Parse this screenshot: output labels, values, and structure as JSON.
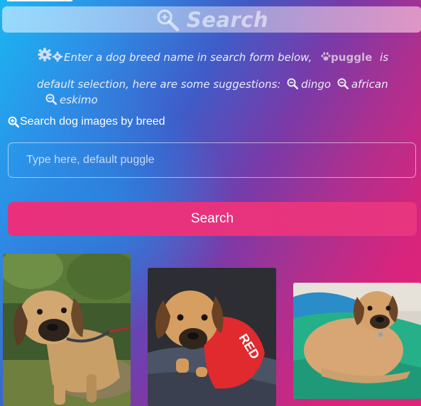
{
  "header": {
    "title": "Search",
    "icon": "search-sparkle-icon"
  },
  "info": {
    "intro": "Enter a dog breed name in search form below,",
    "default_breed": "puggle",
    "is_text": "is",
    "line2_prefix": "default selection, here are some suggestions:",
    "suggestions": [
      "dingo",
      "african",
      "eskimo"
    ]
  },
  "form": {
    "label": "Search dog images by breed",
    "placeholder": "Type here, default puggle",
    "value": "",
    "button_label": "Search"
  },
  "gallery": {
    "breed": "puggle",
    "images": [
      {
        "name": "dog-photo-1",
        "description_icon": "puggle-outdoor"
      },
      {
        "name": "dog-photo-2",
        "description_icon": "puggle-red-shirt"
      },
      {
        "name": "dog-photo-3",
        "description_icon": "puggle-on-cushion"
      }
    ]
  },
  "colors": {
    "gradient_left": "#1ab6f2",
    "gradient_mid": "#7a3aa8",
    "gradient_right": "#e0237a",
    "button": "#e8307c"
  }
}
